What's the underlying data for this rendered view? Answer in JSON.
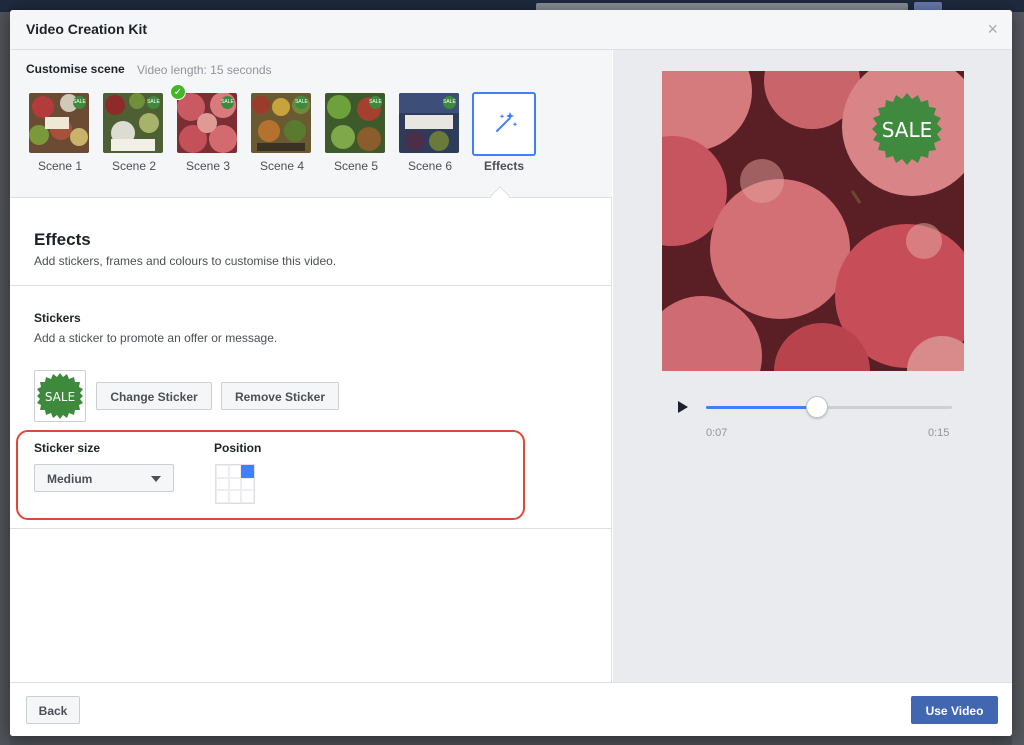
{
  "dialog": {
    "title": "Video Creation Kit",
    "close_glyph": "×"
  },
  "customise": {
    "title": "Customise scene",
    "length_label": "Video length: 15 seconds",
    "scenes": [
      {
        "label": "Scene 1",
        "thumb_color": "#7a5a3a",
        "selected": false
      },
      {
        "label": "Scene 2",
        "thumb_color": "#5b6b3c",
        "selected": true
      },
      {
        "label": "Scene 3",
        "thumb_color": "#b0464f",
        "selected": false
      },
      {
        "label": "Scene 4",
        "thumb_color": "#7d6a3c",
        "selected": false
      },
      {
        "label": "Scene 5",
        "thumb_color": "#567a34",
        "selected": false
      },
      {
        "label": "Scene 6",
        "thumb_color": "#3b4a6a",
        "selected": false
      }
    ],
    "mini_sticker": "SALE",
    "effects_tab_label": "Effects",
    "effects_icon": "magic-wand-icon"
  },
  "effects": {
    "title": "Effects",
    "subtitle": "Add stickers, frames and colours to customise this video."
  },
  "stickers": {
    "title": "Stickers",
    "subtitle": "Add a sticker to promote an offer or message.",
    "sticker_text": "SALE",
    "change_label": "Change Sticker",
    "remove_label": "Remove Sticker",
    "size_label": "Sticker size",
    "size_value": "Medium",
    "position_label": "Position",
    "position_selected": "top-right"
  },
  "player": {
    "sticker_text": "SALE",
    "current_time": "0:07",
    "total_time": "0:15",
    "progress_fraction": 0.45
  },
  "footer": {
    "back_label": "Back",
    "use_label": "Use Video"
  },
  "colors": {
    "accent": "#4080ff",
    "primary_button": "#4267b2",
    "sticker_green": "#3d8a3c",
    "highlight_red": "#e0473a",
    "check_green": "#42b72a"
  }
}
